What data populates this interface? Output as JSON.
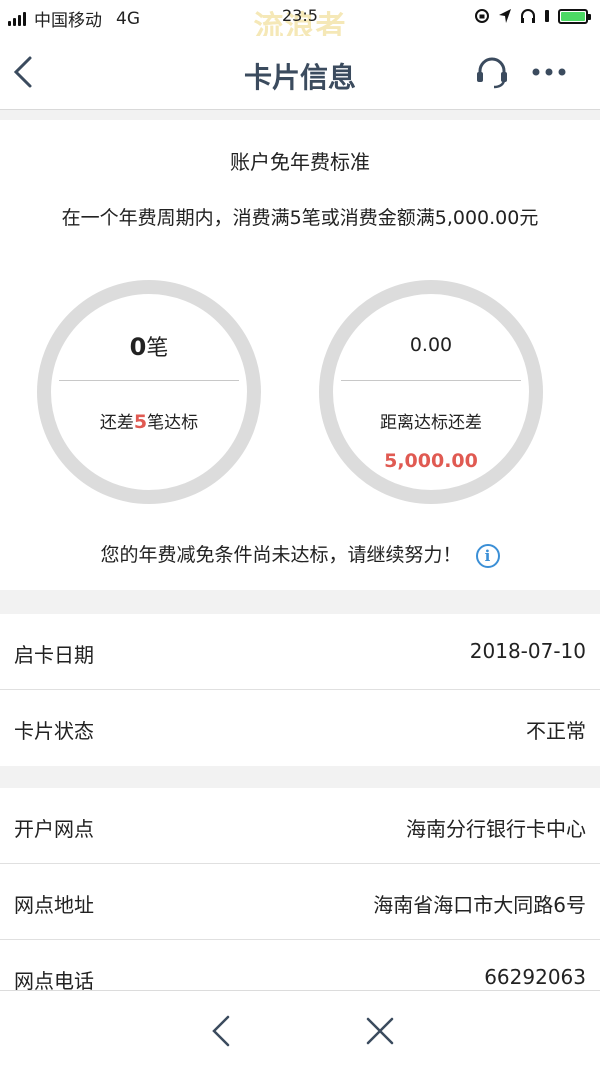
{
  "status_bar": {
    "carrier": "中国移动",
    "network": "4G",
    "time": "23:5",
    "watermark": "流浪者"
  },
  "nav": {
    "title": "卡片信息",
    "icons": [
      "back-icon",
      "headset-icon",
      "more-icon"
    ]
  },
  "summary": {
    "title": "账户免年费标准",
    "description": "在一个年费周期内，消费满5笔或消费金额满5,000.00元",
    "count_card": {
      "value": "0",
      "unit": "笔",
      "remain_prefix": "还差",
      "remain_num": "5",
      "remain_suffix": "笔达标"
    },
    "amount_card": {
      "value": "0.00",
      "label": "距离达标还差",
      "remain": "5,000.00"
    },
    "notice": "您的年费减免条件尚未达标，请继续努力！"
  },
  "card_info": [
    {
      "label": "启卡日期",
      "value": "2018-07-10"
    },
    {
      "label": "卡片状态",
      "value": "不正常"
    }
  ],
  "branch_info": [
    {
      "label": "开户网点",
      "value": "海南分行银行卡中心"
    },
    {
      "label": "网点地址",
      "value": "海南省海口市大同路6号"
    },
    {
      "label": "网点电话",
      "value": "66292063"
    }
  ],
  "colors": {
    "accent_red": "#e05a52",
    "info_blue": "#3b8fd6",
    "title_color": "#3b4b5e",
    "ring_gray": "#dcdcdc"
  }
}
